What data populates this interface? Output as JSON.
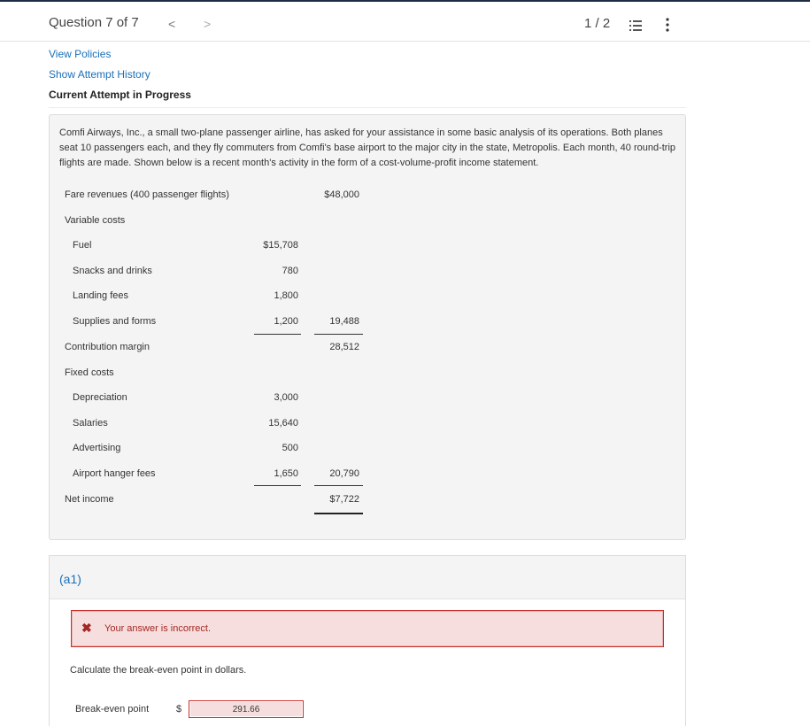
{
  "header": {
    "question_label": "Question 7 of 7",
    "prev": "<",
    "next": ">",
    "page_indicator": "1 / 2",
    "list_icon": "list-icon",
    "more_icon": "more-vertical-icon"
  },
  "links": {
    "view_policies": "View Policies",
    "show_attempt_history": "Show Attempt History",
    "current_attempt": "Current Attempt in Progress"
  },
  "problem": {
    "text": "Comfi Airways, Inc., a small two-plane passenger airline, has asked for your assistance in some basic analysis of its operations. Both planes seat 10 passengers each, and they fly commuters from Comfi's base airport to the major city in the state, Metropolis. Each month, 40 round-trip flights are made. Shown below is a recent month's activity in the form of a cost-volume-profit income statement.",
    "statement": {
      "fare_revenues_label": "Fare revenues (400 passenger flights)",
      "fare_revenues_value": "$48,000",
      "variable_costs_label": "Variable costs",
      "fuel_label": "Fuel",
      "fuel_value": "$15,708",
      "snacks_label": "Snacks and drinks",
      "snacks_value": "780",
      "landing_label": "Landing fees",
      "landing_value": "1,800",
      "supplies_label": "Supplies and forms",
      "supplies_value": "1,200",
      "variable_total": "19,488",
      "contribution_label": "Contribution margin",
      "contribution_value": "28,512",
      "fixed_costs_label": "Fixed costs",
      "depreciation_label": "Depreciation",
      "depreciation_value": "3,000",
      "salaries_label": "Salaries",
      "salaries_value": "15,640",
      "advertising_label": "Advertising",
      "advertising_value": "500",
      "hanger_label": "Airport hanger fees",
      "hanger_value": "1,650",
      "fixed_total": "20,790",
      "net_income_label": "Net income",
      "net_income_value": "$7,722"
    }
  },
  "part": {
    "label": "(a1)",
    "alert_icon": "x-mark-icon",
    "alert_text": "Your answer is incorrect.",
    "instruction": "Calculate the break-even point in dollars.",
    "input_label": "Break-even point",
    "currency": "$",
    "input_value": "291.66"
  },
  "colors": {
    "link": "#1b6fb8",
    "error_border": "#c9302c",
    "error_bg": "#f7dede",
    "panel_bg": "#f4f4f4"
  }
}
